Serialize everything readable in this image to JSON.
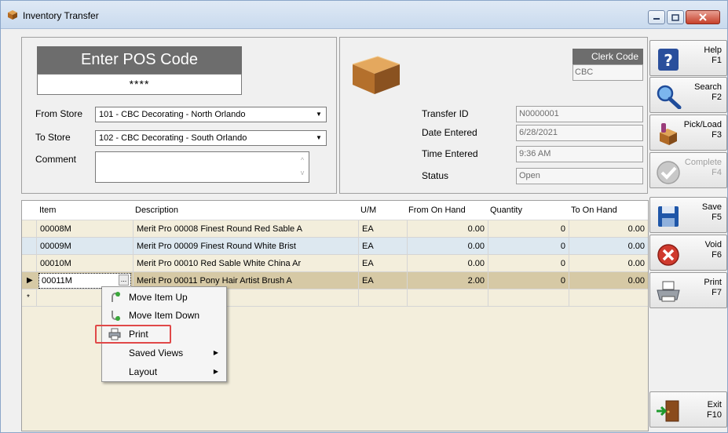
{
  "window": {
    "title": "Inventory Transfer"
  },
  "pos": {
    "header": "Enter POS Code",
    "value": "****"
  },
  "form": {
    "from_store_label": "From Store",
    "from_store_value": "101 - CBC Decorating - North Orlando",
    "to_store_label": "To Store",
    "to_store_value": "102 - CBC Decorating - South Orlando",
    "comment_label": "Comment",
    "comment_value": ""
  },
  "info": {
    "clerk_code_label": "Clerk Code",
    "clerk_code_value": "CBC",
    "transfer_id_label": "Transfer ID",
    "transfer_id_value": "N0000001",
    "date_entered_label": "Date Entered",
    "date_entered_value": "6/28/2021",
    "time_entered_label": "Time Entered",
    "time_entered_value": "9:36 AM",
    "status_label": "Status",
    "status_value": "Open"
  },
  "side_buttons": [
    {
      "label": "Help",
      "key": "F1",
      "icon": "help-icon",
      "enabled": true
    },
    {
      "label": "Search",
      "key": "F2",
      "icon": "search-icon",
      "enabled": true
    },
    {
      "label": "Pick/Load",
      "key": "F3",
      "icon": "pick-load-icon",
      "enabled": true
    },
    {
      "label": "Complete",
      "key": "F4",
      "icon": "check-icon",
      "enabled": false
    },
    {
      "label": "Save",
      "key": "F5",
      "icon": "floppy-icon",
      "enabled": true
    },
    {
      "label": "Void",
      "key": "F6",
      "icon": "void-icon",
      "enabled": true
    },
    {
      "label": "Print",
      "key": "F7",
      "icon": "printer-icon",
      "enabled": true
    },
    {
      "label": "Exit",
      "key": "F10",
      "icon": "exit-door-icon",
      "enabled": true
    }
  ],
  "grid": {
    "columns": [
      "Item",
      "Description",
      "U/M",
      "From On Hand",
      "Quantity",
      "To On Hand"
    ],
    "rows": [
      {
        "item": "00008M",
        "description": "Merit Pro 00008 Finest Round Red Sable A",
        "um": "EA",
        "from_on_hand": "0.00",
        "quantity": "0",
        "to_on_hand": "0.00"
      },
      {
        "item": "00009M",
        "description": "Merit Pro 00009 Finest Round White Brist",
        "um": "EA",
        "from_on_hand": "0.00",
        "quantity": "0",
        "to_on_hand": "0.00"
      },
      {
        "item": "00010M",
        "description": "Merit Pro 00010 Red Sable White China Ar",
        "um": "EA",
        "from_on_hand": "0.00",
        "quantity": "0",
        "to_on_hand": "0.00"
      },
      {
        "item": "00011M",
        "description": "Merit Pro 00011 Pony Hair Artist Brush A",
        "um": "EA",
        "from_on_hand": "2.00",
        "quantity": "0",
        "to_on_hand": "0.00"
      }
    ],
    "ellipsis": "...",
    "current_indicator": "▶",
    "new_row_indicator": "*"
  },
  "context_menu": {
    "items": [
      {
        "label": "Move Item Up",
        "icon": "move-up-icon",
        "has_submenu": false
      },
      {
        "label": "Move Item Down",
        "icon": "move-down-icon",
        "has_submenu": false
      },
      {
        "label": "Print",
        "icon": "printer-icon",
        "has_submenu": false
      },
      {
        "label": "Saved Views",
        "icon": "",
        "has_submenu": true
      },
      {
        "label": "Layout",
        "icon": "",
        "has_submenu": true
      }
    ],
    "highlight_color": "#e04848"
  }
}
